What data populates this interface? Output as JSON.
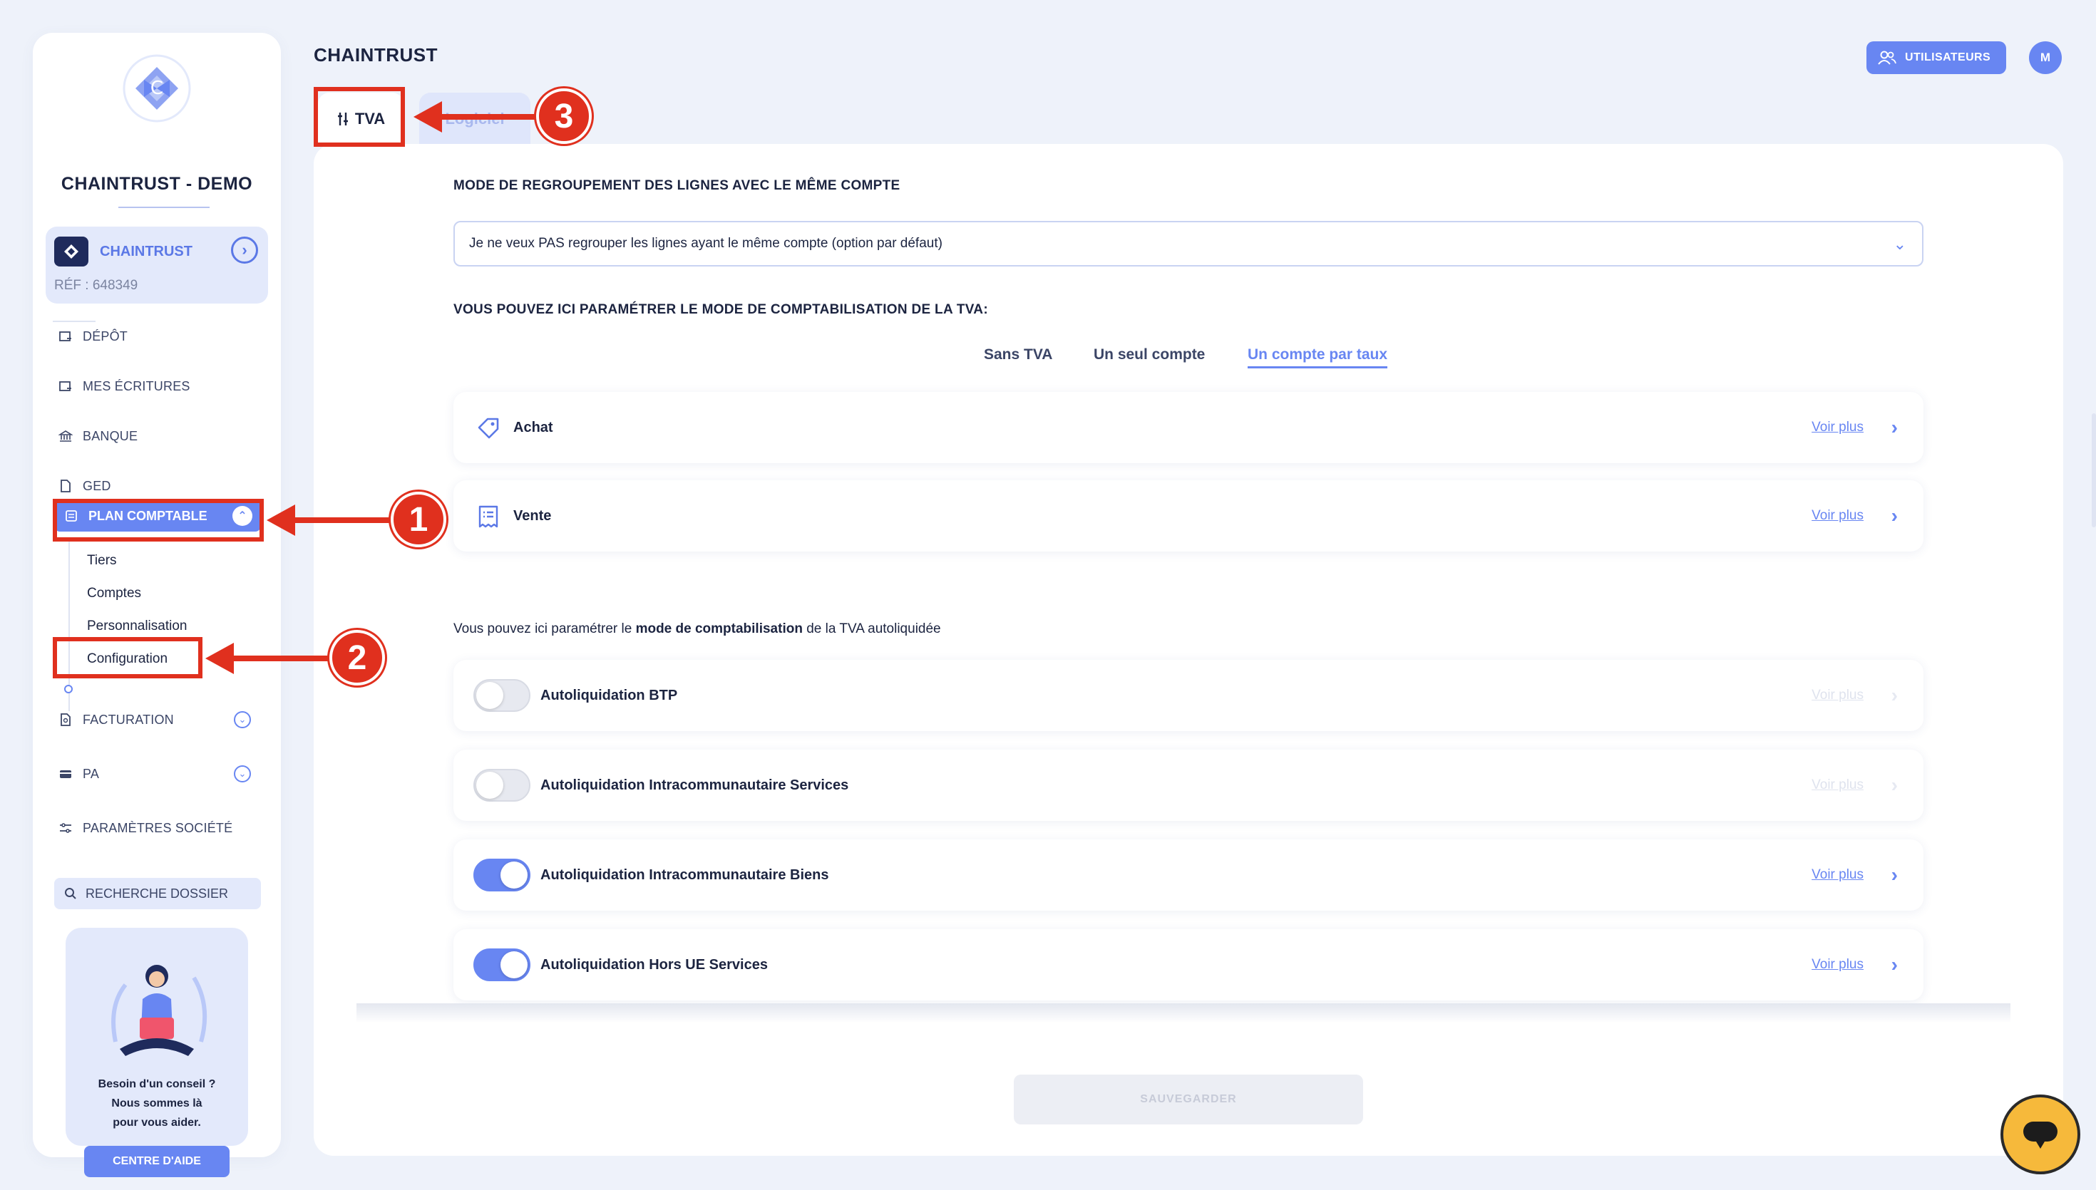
{
  "header": {
    "title": "CHAINTRUST",
    "users_button": "UTILISATEURS",
    "avatar_initial": "M"
  },
  "sidebar": {
    "company_name": "CHAINTRUST - DEMO",
    "client": {
      "name": "CHAINTRUST",
      "ref": "RÉF : 648349"
    },
    "items": [
      {
        "label": "DÉPÔT",
        "icon": "upload-icon"
      },
      {
        "label": "MES ÉCRITURES",
        "icon": "entries-icon"
      },
      {
        "label": "BANQUE",
        "icon": "bank-icon"
      },
      {
        "label": "GED",
        "icon": "document-icon"
      }
    ],
    "active_item": {
      "label": "PLAN COMPTABLE",
      "icon": "ledger-icon"
    },
    "subitems": [
      "Tiers",
      "Comptes",
      "Personnalisation",
      "Configuration"
    ],
    "facturation": "FACTURATION",
    "pa": "PA",
    "parametres": "PARAMÈTRES SOCIÉTÉ",
    "search": "RECHERCHE DOSSIER",
    "help": {
      "line1": "Besoin d'un conseil ?",
      "line2": "Nous sommes là",
      "line3": "pour vous aider.",
      "button": "CENTRE D'AIDE"
    }
  },
  "tabs": [
    {
      "label": "TVA",
      "icon": "sliders-icon"
    },
    {
      "label": "Logiciel"
    }
  ],
  "main": {
    "group_label": "MODE DE REGROUPEMENT DES LIGNES AVEC LE MÊME COMPTE",
    "group_value": "Je ne veux PAS regrouper les lignes ayant le même compte (option par défaut)",
    "tva_label": "VOUS POUVEZ ICI PARAMÉTRER LE MODE DE COMPTABILISATION DE LA TVA:",
    "modes": [
      "Sans TVA",
      "Un seul compte",
      "Un compte par taux"
    ],
    "active_mode": "Un compte par taux",
    "rows": [
      {
        "label": "Achat",
        "icon": "tag-icon",
        "link": "Voir plus"
      },
      {
        "label": "Vente",
        "icon": "receipt-icon",
        "link": "Voir plus"
      }
    ],
    "reverse_text_before": "Vous pouvez ici paramétrer le ",
    "reverse_text_bold": "mode de comptabilisation",
    "reverse_text_after": " de la TVA autoliquidée",
    "toggles": [
      {
        "label": "Autoliquidation BTP",
        "on": false,
        "link": "Voir plus"
      },
      {
        "label": "Autoliquidation Intracommunautaire Services",
        "on": false,
        "link": "Voir plus"
      },
      {
        "label": "Autoliquidation Intracommunautaire Biens",
        "on": true,
        "link": "Voir plus"
      },
      {
        "label": "Autoliquidation Hors UE Services",
        "on": true,
        "link": "Voir plus"
      }
    ],
    "save_button": "SAUVEGARDER"
  },
  "annotations": [
    "1",
    "2",
    "3"
  ],
  "colors": {
    "accent": "#6886f2",
    "annotation": "#e0301e",
    "chat": "#f6b93b"
  }
}
